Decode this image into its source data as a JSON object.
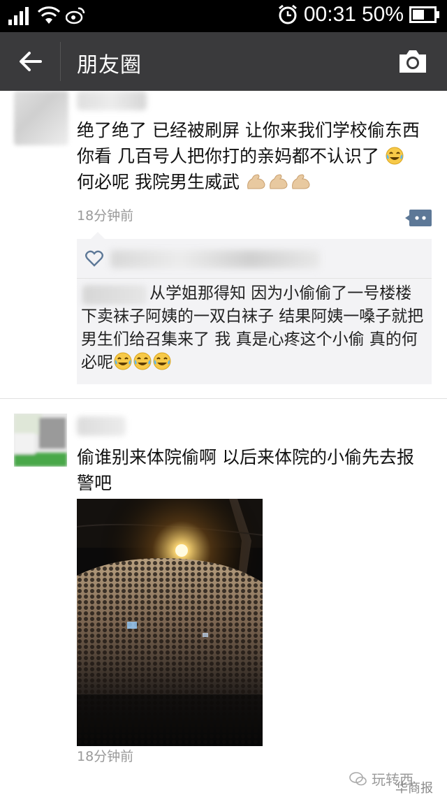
{
  "status_bar": {
    "time": "00:31",
    "battery_percent": "50%",
    "icons": [
      "signal-icon",
      "wifi-icon",
      "weibo-icon",
      "alarm-icon",
      "battery-icon"
    ]
  },
  "nav": {
    "title": "朋友圈",
    "back_icon": "back-arrow-icon",
    "camera_icon": "camera-icon"
  },
  "posts": [
    {
      "text_parts": [
        "绝了绝了 已经被刷屏 让你来我们学校偷东西 你看 几百号人把你打的亲妈都不认识了",
        " 何必呢 我院男生威武"
      ],
      "time": "18分钟前",
      "comment": {
        "text": "从学姐那得知 因为小偷偷了一号楼楼下卖袜子阿姨的一双白袜子 结果阿姨一嗓子就把男生们给召集来了 我 真是心疼这个小偷 真的何必呢"
      }
    },
    {
      "text": "偷谁别来体院偷啊 以后来体院的小偷先去报警吧",
      "time": "18分钟前"
    }
  ],
  "watermark": {
    "brand": "玩转西",
    "source": "华商报"
  },
  "colors": {
    "status_bar_bg": "#000000",
    "nav_bg": "#3a3a3c",
    "timestamp": "#999999",
    "comment_bg": "#f3f3f5"
  }
}
